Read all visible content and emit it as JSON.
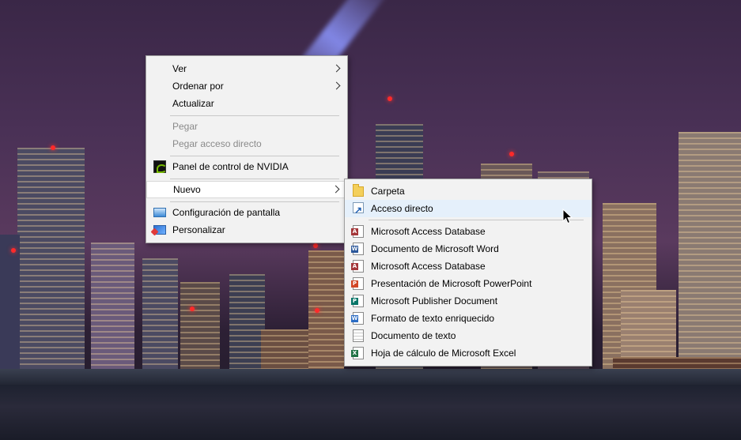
{
  "context_menu": {
    "items": [
      {
        "label": "Ver",
        "submenu": true
      },
      {
        "label": "Ordenar por",
        "submenu": true
      },
      {
        "label": "Actualizar"
      },
      {
        "label": "Pegar",
        "disabled": true
      },
      {
        "label": "Pegar acceso directo",
        "disabled": true
      },
      {
        "label": "Panel de control de NVIDIA",
        "icon": "nvidia-icon"
      },
      {
        "label": "Nuevo",
        "submenu": true,
        "highlighted": true
      },
      {
        "label": "Configuración de pantalla",
        "icon": "display-settings-icon"
      },
      {
        "label": "Personalizar",
        "icon": "personalize-icon"
      }
    ]
  },
  "new_submenu": {
    "items": [
      {
        "label": "Carpeta",
        "icon": "folder-icon"
      },
      {
        "label": "Acceso directo",
        "icon": "shortcut-icon",
        "hovered": true
      },
      {
        "label": "Microsoft Access Database",
        "icon": "access-icon",
        "icon_letter": "A"
      },
      {
        "label": "Documento de Microsoft Word",
        "icon": "word-icon",
        "icon_letter": "W"
      },
      {
        "label": "Microsoft Access Database",
        "icon": "access-icon",
        "icon_letter": "A"
      },
      {
        "label": "Presentación de Microsoft PowerPoint",
        "icon": "powerpoint-icon",
        "icon_letter": "P"
      },
      {
        "label": "Microsoft Publisher Document",
        "icon": "publisher-icon",
        "icon_letter": "P"
      },
      {
        "label": "Formato de texto enriquecido",
        "icon": "rich-text-icon",
        "icon_letter": "W"
      },
      {
        "label": "Documento de texto",
        "icon": "text-document-icon"
      },
      {
        "label": "Hoja de cálculo de Microsoft Excel",
        "icon": "excel-icon",
        "icon_letter": "X"
      }
    ]
  },
  "colors": {
    "menu_background": "#f2f2f2",
    "hover": "#e5f0fb",
    "disabled_text": "#8a8a8a"
  }
}
